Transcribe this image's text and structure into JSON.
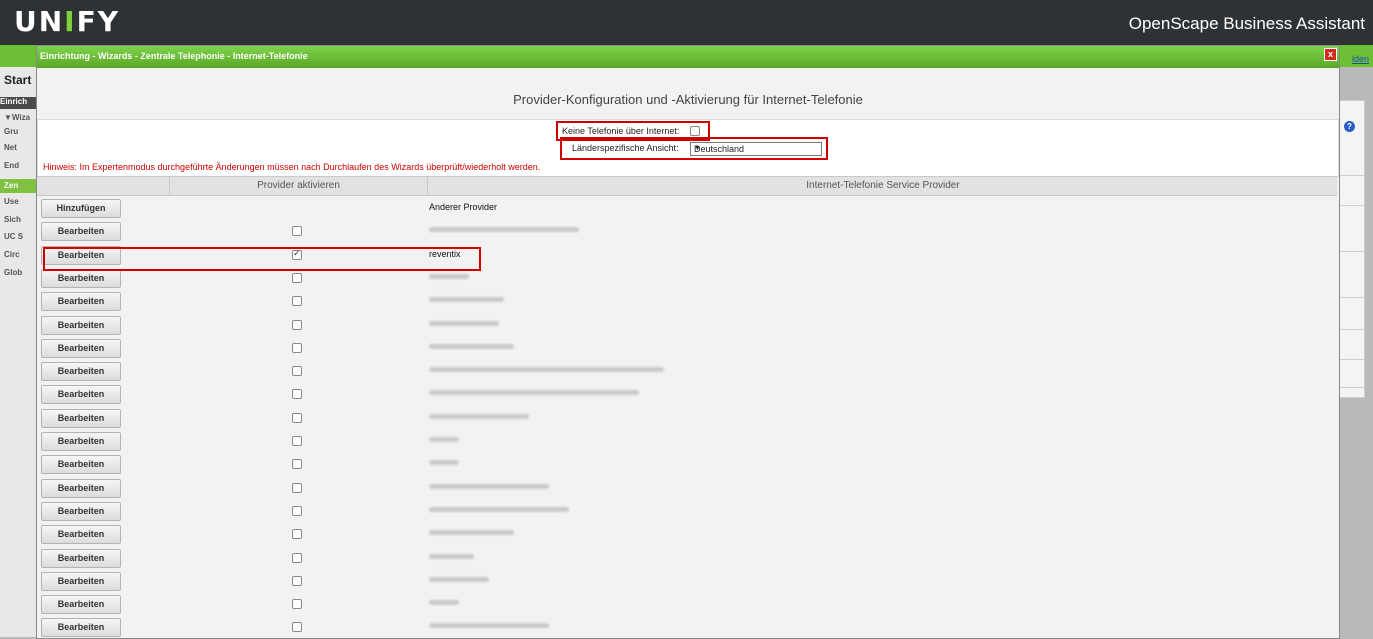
{
  "app": {
    "brand": "unify",
    "product_name": "OpenScape Business Assistant",
    "logout_fragment": "lden"
  },
  "background": {
    "start_label": "Start",
    "nav_header": "Einrich",
    "nav_items": [
      "▼Wiza",
      "Gru",
      "Net",
      "End",
      "Zen",
      "Use",
      "Sich",
      "UC S",
      "Circ",
      "Glob"
    ],
    "nav_selected_index": 4
  },
  "dialog": {
    "title": "Einrichtung - Wizards - Zentrale Telephonie - Internet-Telefonie",
    "close_label": "x",
    "heading": "Provider-Konfiguration und -Aktivierung für Internet-Telefonie",
    "no_internet_label": "Keine Telefonie über Internet:",
    "country_label": "Länderspezifische Ansicht:",
    "country_value": "Deutschland",
    "hint": "Hinweis: Im Expertenmodus durchgeführte Änderungen müssen nach Durchlaufen des Wizards überprüft/wiederholt werden.",
    "col_activate": "Provider aktivieren",
    "col_provider": "Internet-Telefonie Service Provider"
  },
  "rows": [
    {
      "button": "Hinzufügen",
      "has_checkbox": false,
      "checked": false,
      "provider": "Anderer Provider",
      "blurred": false
    },
    {
      "button": "Bearbeiten",
      "has_checkbox": true,
      "checked": false,
      "provider": "",
      "blurred": true,
      "blur_w": 150
    },
    {
      "button": "Bearbeiten",
      "has_checkbox": true,
      "checked": true,
      "provider": "reventix",
      "blurred": false
    },
    {
      "button": "Bearbeiten",
      "has_checkbox": true,
      "checked": false,
      "provider": "",
      "blurred": true,
      "blur_w": 40
    },
    {
      "button": "Bearbeiten",
      "has_checkbox": true,
      "checked": false,
      "provider": "",
      "blurred": true,
      "blur_w": 75
    },
    {
      "button": "Bearbeiten",
      "has_checkbox": true,
      "checked": false,
      "provider": "",
      "blurred": true,
      "blur_w": 70
    },
    {
      "button": "Bearbeiten",
      "has_checkbox": true,
      "checked": false,
      "provider": "",
      "blurred": true,
      "blur_w": 85
    },
    {
      "button": "Bearbeiten",
      "has_checkbox": true,
      "checked": false,
      "provider": "",
      "blurred": true,
      "blur_w": 235
    },
    {
      "button": "Bearbeiten",
      "has_checkbox": true,
      "checked": false,
      "provider": "",
      "blurred": true,
      "blur_w": 210
    },
    {
      "button": "Bearbeiten",
      "has_checkbox": true,
      "checked": false,
      "provider": "",
      "blurred": true,
      "blur_w": 100
    },
    {
      "button": "Bearbeiten",
      "has_checkbox": true,
      "checked": false,
      "provider": "",
      "blurred": true,
      "blur_w": 30
    },
    {
      "button": "Bearbeiten",
      "has_checkbox": true,
      "checked": false,
      "provider": "",
      "blurred": true,
      "blur_w": 30
    },
    {
      "button": "Bearbeiten",
      "has_checkbox": true,
      "checked": false,
      "provider": "",
      "blurred": true,
      "blur_w": 120
    },
    {
      "button": "Bearbeiten",
      "has_checkbox": true,
      "checked": false,
      "provider": "",
      "blurred": true,
      "blur_w": 140
    },
    {
      "button": "Bearbeiten",
      "has_checkbox": true,
      "checked": false,
      "provider": "",
      "blurred": true,
      "blur_w": 85
    },
    {
      "button": "Bearbeiten",
      "has_checkbox": true,
      "checked": false,
      "provider": "",
      "blurred": true,
      "blur_w": 45
    },
    {
      "button": "Bearbeiten",
      "has_checkbox": true,
      "checked": false,
      "provider": "",
      "blurred": true,
      "blur_w": 60
    },
    {
      "button": "Bearbeiten",
      "has_checkbox": true,
      "checked": false,
      "provider": "",
      "blurred": true,
      "blur_w": 30
    },
    {
      "button": "Bearbeiten",
      "has_checkbox": true,
      "checked": false,
      "provider": "",
      "blurred": true,
      "blur_w": 120
    }
  ],
  "colors": {
    "topbar": "#2f3234",
    "green": "#6dbf36",
    "highlight": "#d00000"
  }
}
